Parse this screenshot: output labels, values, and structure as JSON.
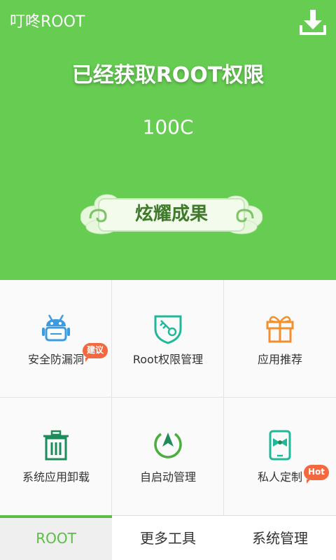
{
  "header": {
    "app_title": "叮咚ROOT",
    "status_title": "已经获取ROOT权限",
    "status_value": "100C",
    "show_button_label": "炫耀成果",
    "download_icon": "download-icon"
  },
  "features": [
    {
      "label": "安全防漏洞",
      "icon": "android-shield-icon",
      "badge": "建议"
    },
    {
      "label": "Root权限管理",
      "icon": "key-shield-icon",
      "badge": ""
    },
    {
      "label": "应用推荐",
      "icon": "gift-icon",
      "badge": ""
    },
    {
      "label": "系统应用卸载",
      "icon": "trash-icon",
      "badge": ""
    },
    {
      "label": "自启动管理",
      "icon": "power-start-icon",
      "badge": ""
    },
    {
      "label": "私人定制",
      "icon": "phone-bow-icon",
      "badge": "Hot"
    }
  ],
  "tabs": [
    {
      "label": "ROOT",
      "active": true
    },
    {
      "label": "更多工具",
      "active": false
    },
    {
      "label": "系统管理",
      "active": false
    }
  ],
  "colors": {
    "header_green": "#66cc52",
    "active_tab": "#5bbd45",
    "badge_orange": "#f4683f",
    "icon_blue": "#3b9be0",
    "icon_teal": "#21b89a",
    "icon_orange": "#f29030"
  }
}
